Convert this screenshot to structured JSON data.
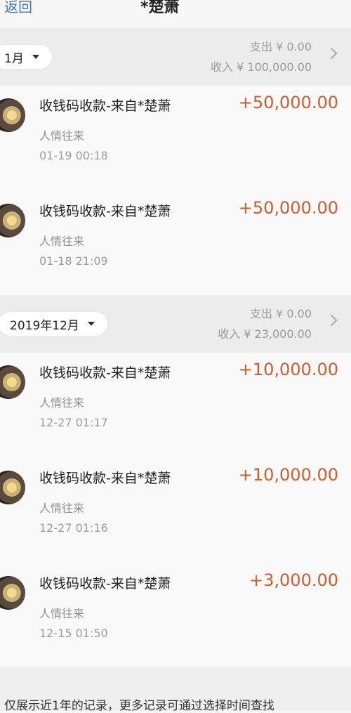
{
  "header": {
    "back_label": "返回",
    "title": "*楚萧"
  },
  "sections": [
    {
      "month": "1月",
      "expense": "支出 ¥ 0.00",
      "income": "收入 ¥ 100,000.00",
      "transactions": [
        {
          "title": "收钱码收款-来自*楚萧",
          "category": "人情往来",
          "time": "01-19  00:18",
          "amount": "+50,000.00"
        },
        {
          "title": "收钱码收款-来自*楚萧",
          "category": "人情往来",
          "time": "01-18  21:09",
          "amount": "+50,000.00"
        }
      ]
    },
    {
      "month": "2019年12月",
      "expense": "支出 ¥ 0.00",
      "income": "收入 ¥ 23,000.00",
      "transactions": [
        {
          "title": "收钱码收款-来自*楚萧",
          "category": "人情往来",
          "time": "12-27  01:17",
          "amount": "+10,000.00"
        },
        {
          "title": "收钱码收款-来自*楚萧",
          "category": "人情往来",
          "time": "12-27  01:16",
          "amount": "+10,000.00"
        },
        {
          "title": "收钱码收款-来自*楚萧",
          "category": "人情往来",
          "time": "12-15  01:50",
          "amount": "+3,000.00"
        }
      ]
    }
  ],
  "footer": {
    "note": "仅展示近1年的记录，更多记录可通过选择时间查找"
  },
  "colors": {
    "accent_link": "#4a74b8",
    "amount": "#d05d2e"
  },
  "icons": {
    "avatar": "payer-avatar",
    "dropdown": "caret-down-icon",
    "chevron": "chevron-right-icon"
  }
}
